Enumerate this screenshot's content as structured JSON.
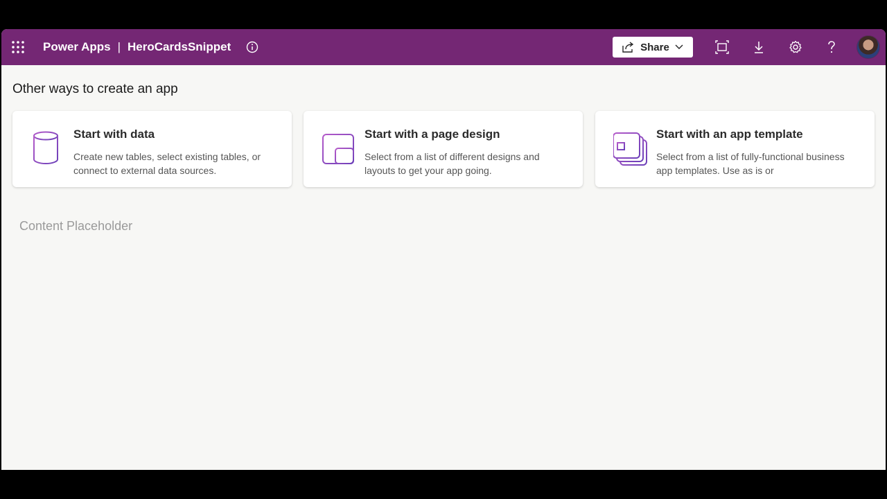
{
  "header": {
    "app_name": "Power Apps",
    "separator": "|",
    "project_name": "HeroCardsSnippet",
    "share_label": "Share",
    "icons": [
      "waffle-icon",
      "info-icon",
      "share-icon",
      "chevron-down-icon",
      "fit-to-screen-icon",
      "download-icon",
      "settings-icon",
      "help-icon"
    ]
  },
  "main": {
    "section_title": "Other ways to create an app",
    "cards": [
      {
        "title": "Start with data",
        "description": "Create new tables, select existing tables, or connect to external data sources.",
        "icon": "database-icon"
      },
      {
        "title": "Start with a page design",
        "description": "Select from a list of different designs and layouts to get your app going.",
        "icon": "page-design-icon"
      },
      {
        "title": "Start with an app template",
        "description": "Select from a list of fully-functional business app templates. Use as is or",
        "icon": "app-template-icon"
      }
    ],
    "placeholder_text": "Content Placeholder"
  },
  "colors": {
    "header_bg": "#742774",
    "page_bg": "#f7f7f5",
    "icon_gradient_start": "#b45ac9",
    "icon_gradient_end": "#6b3fb8"
  }
}
